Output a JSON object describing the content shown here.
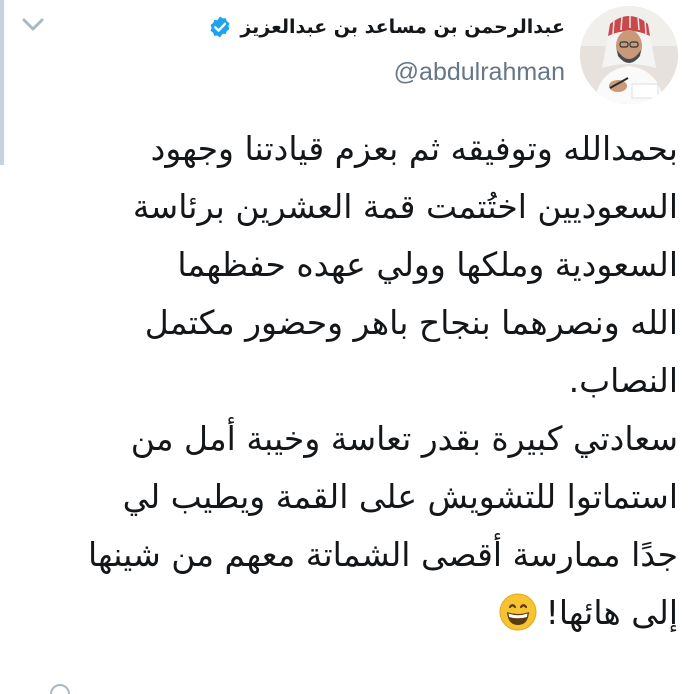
{
  "tweet": {
    "author": {
      "display_name": "عبدالرحمن بن مساعد بن عبدالعزيز",
      "handle": "@abdulrahman",
      "verified": true,
      "verified_icon": "verified-badge-icon",
      "avatar_icon": "profile-photo"
    },
    "menu_icon": "chevron-down-icon",
    "lines": [
      "بحمدالله وتوفيقه ثم بعزم قيادتنا وجهود",
      "السعوديين اختُتمت قمة العشرين برئاسة",
      "السعودية وملكها وولي عهده حفظهما",
      "الله ونصرهما بنجاح باهر وحضور مكتمل",
      "النصاب.",
      "سعادتي كبيرة بقدر تعاسة وخيبة أمل من",
      "استماتوا للتشويش على القمة ويطيب لي",
      "جدًا  ممارسة أقصى الشماتة معهم من شينها",
      "إلى هائها!"
    ],
    "emoji": "grinning-face-emoji",
    "colors": {
      "text": "#14171a",
      "secondary": "#657786",
      "verified": "#1da1f2",
      "emoji": "#f7c331"
    }
  }
}
